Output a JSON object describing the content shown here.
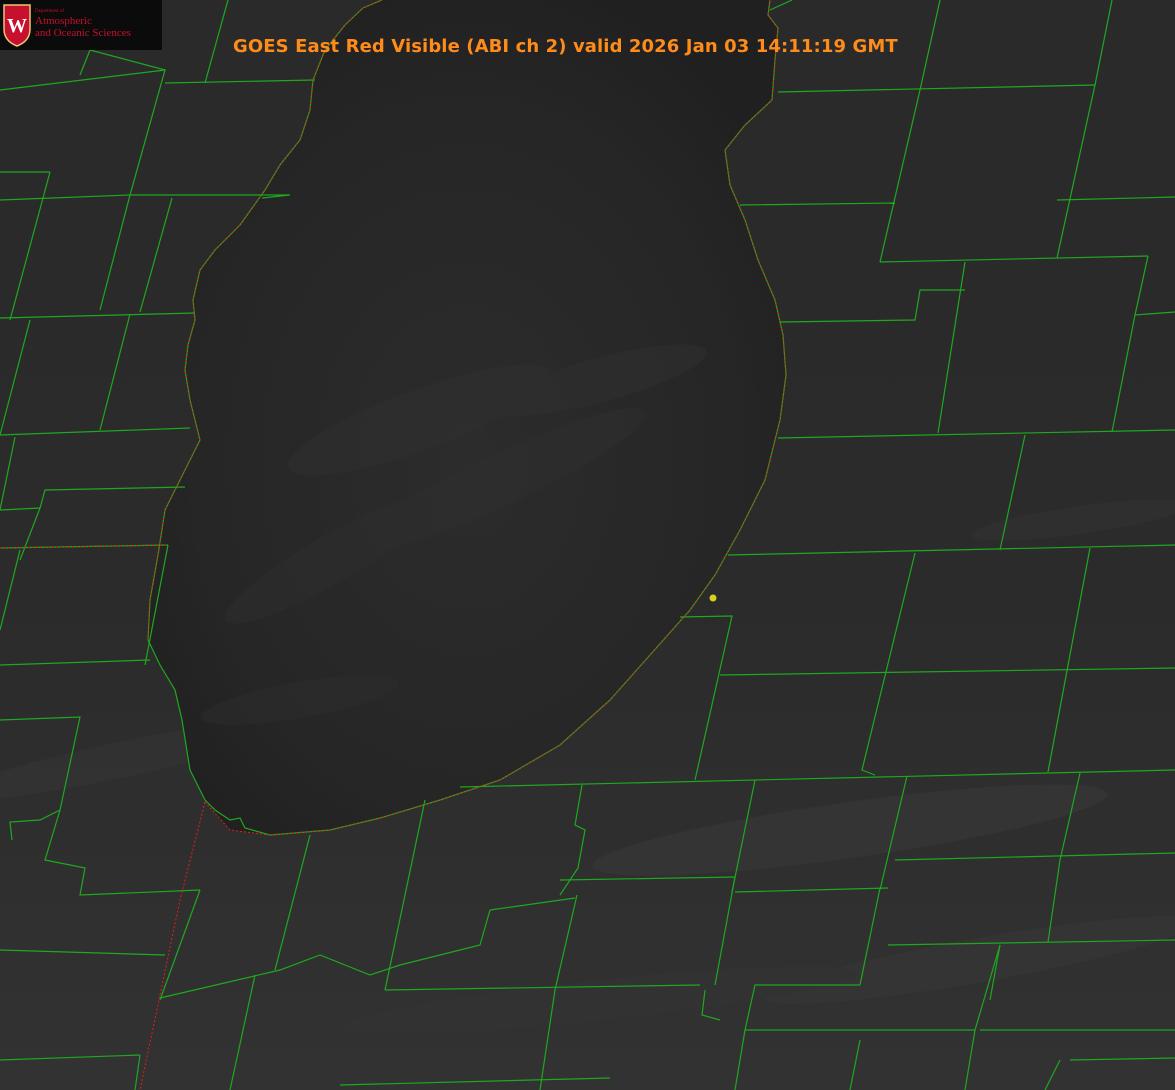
{
  "header": {
    "title": "GOES East Red Visible (ABI ch 2) valid 2026 Jan 03 14:11:19 GMT"
  },
  "logo": {
    "department_line": "Department of",
    "name_line_1": "Atmospheric",
    "name_line_2": "and Oceanic Sciences",
    "seal_letter": "W"
  },
  "map": {
    "imagery": "satellite-visible",
    "lake": "lake-water",
    "boundary_color": "#1fa81f",
    "shoreline_color": "#e0201a",
    "point_marker_color": "#d8d020",
    "background_color": "#262626"
  }
}
